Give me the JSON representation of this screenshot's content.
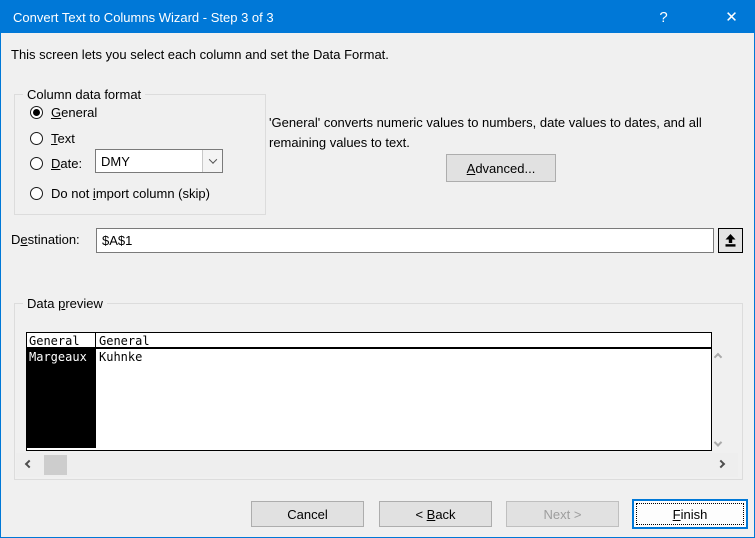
{
  "window": {
    "title": "Convert Text to Columns Wizard - Step 3 of 3",
    "help_label": "?",
    "close_label": "✕"
  },
  "colors": {
    "titlebar": "#0078d7",
    "accent": "#0078d7",
    "selection_bg": "#000000",
    "selection_fg": "#ffffff"
  },
  "description": "This screen lets you select each column and set the Data Format.",
  "format_group": {
    "title": "Column data format",
    "selected_option": "General",
    "option_general": {
      "pre": "",
      "u": "G",
      "post": "eneral"
    },
    "option_text": {
      "pre": "",
      "u": "T",
      "post": "ext"
    },
    "option_date": {
      "pre": "",
      "u": "D",
      "post": "ate:"
    },
    "option_skip": {
      "pre": "Do not ",
      "u": "i",
      "post": "mport column (skip)"
    },
    "date_format_value": "DMY"
  },
  "info": {
    "line1": "'General' converts numeric values to numbers, date values to dates, and all",
    "line2": "remaining values to text."
  },
  "advanced_button": {
    "pre": "",
    "u": "A",
    "post": "dvanced..."
  },
  "destination": {
    "label": {
      "pre": "D",
      "u": "e",
      "post": "stination:"
    },
    "value": "$A$1"
  },
  "data_preview": {
    "label": {
      "pre": "Data ",
      "u": "p",
      "post": "review"
    },
    "columns": [
      {
        "header": "General",
        "value": "Margeaux",
        "selected": true
      },
      {
        "header": "General",
        "value": "Kuhnke",
        "selected": false
      }
    ]
  },
  "buttons": {
    "cancel": "Cancel",
    "back": {
      "pre": "< ",
      "u": "B",
      "post": "ack"
    },
    "next": "Next >",
    "finish": {
      "pre": "",
      "u": "F",
      "post": "inish"
    }
  }
}
